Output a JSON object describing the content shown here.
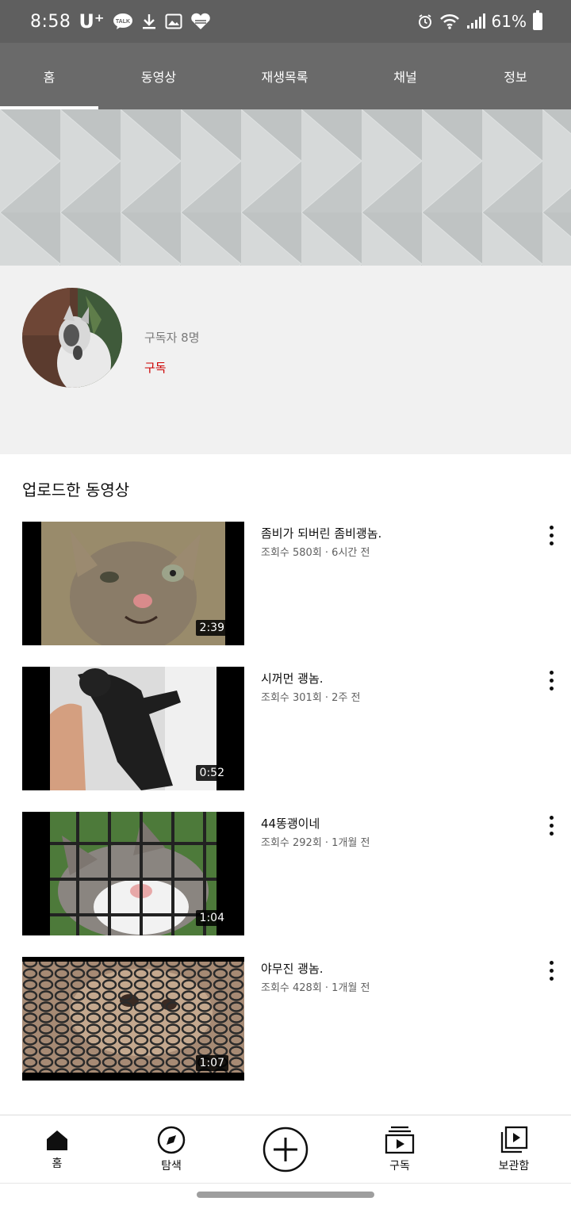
{
  "status_bar": {
    "time": "8:58",
    "carrier": "U⁺",
    "talk_badge": "TALK",
    "battery_text": "61%"
  },
  "tabs": [
    {
      "label": "홈",
      "active": true
    },
    {
      "label": "동영상",
      "active": false
    },
    {
      "label": "재생목록",
      "active": false
    },
    {
      "label": "채널",
      "active": false
    },
    {
      "label": "정보",
      "active": false
    }
  ],
  "channel": {
    "subscriber_count": "구독자 8명",
    "subscribe_label": "구독"
  },
  "uploads": {
    "section_title": "업로드한 동영상",
    "videos": [
      {
        "title": "좀비가 되버린 좀비괭놈.",
        "meta": "조회수 580회 · 6시간 전",
        "duration": "2:39"
      },
      {
        "title": "시꺼먼 괭놈.",
        "meta": "조회수 301회 · 2주 전",
        "duration": "0:52"
      },
      {
        "title": "44똥괭이네",
        "meta": "조회수 292회 · 1개월 전",
        "duration": "1:04"
      },
      {
        "title": "야무진 괭놈.",
        "meta": "조회수 428회 · 1개월 전",
        "duration": "1:07"
      }
    ]
  },
  "bottom_nav": [
    {
      "label": "홈",
      "icon": "home-icon"
    },
    {
      "label": "탐색",
      "icon": "compass-icon"
    },
    {
      "label": "",
      "icon": "create-plus-icon"
    },
    {
      "label": "구독",
      "icon": "subscriptions-icon"
    },
    {
      "label": "보관함",
      "icon": "library-icon"
    }
  ],
  "colors": {
    "status_bar_bg": "#5f5f5f",
    "tab_bar_bg": "#6a6a6a",
    "subscribe_red": "#cc0000",
    "channel_info_bg": "#f1f1f1"
  }
}
